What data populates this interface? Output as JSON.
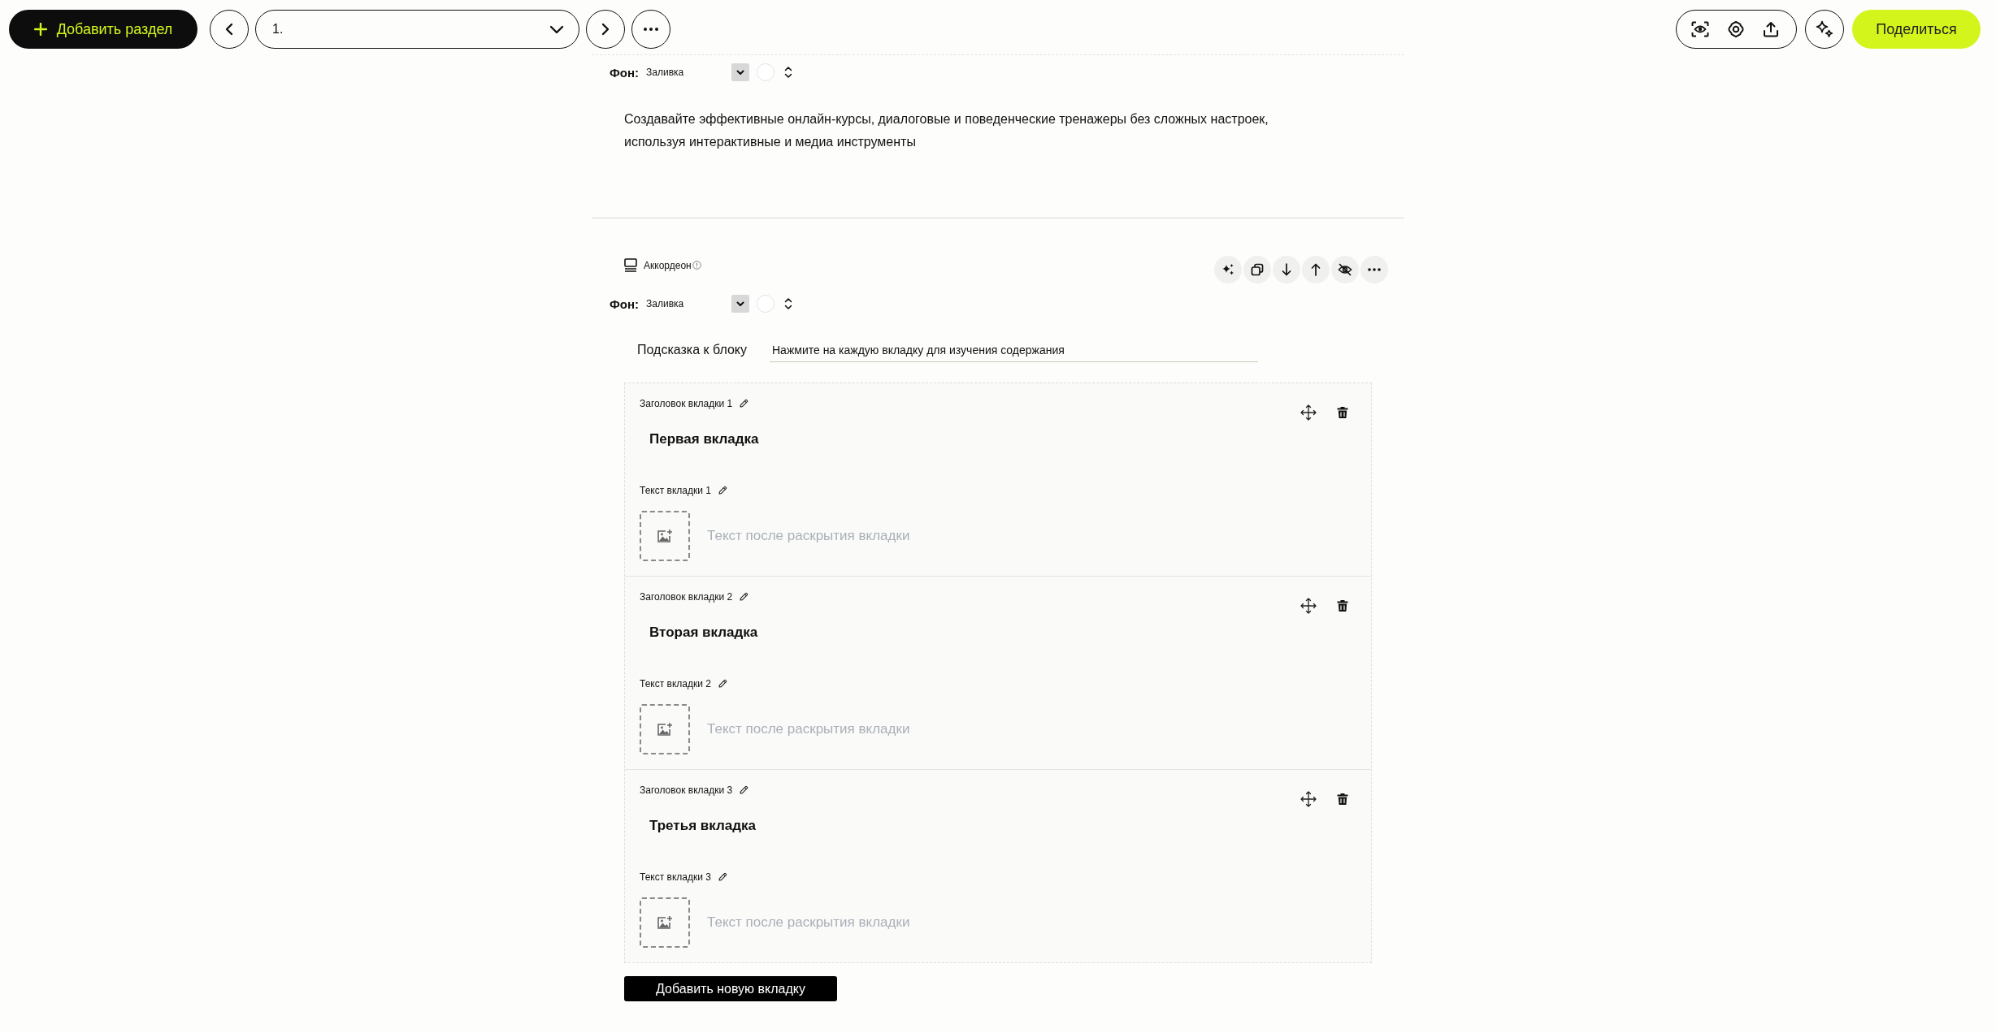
{
  "top_bar": {
    "add_section_button": "Добавить раздел",
    "section_select": {
      "value": "1."
    },
    "share_button": "Поделиться"
  },
  "blocks": [
    {
      "kind": "text",
      "background": {
        "label": "Фон:",
        "value": "Заливка"
      },
      "text": "Создавайте эффективные онлайн-курсы, диалоговые и поведенческие тренажеры без сложных настроек, используя интерактивные и медиа инструменты"
    },
    {
      "kind": "accordion",
      "type_label": "Аккордеон",
      "background": {
        "label": "Фон:",
        "value": "Заливка"
      },
      "hint": {
        "label": "Подсказка к блоку",
        "value": "Нажмите на каждую вкладку для изучения содержания"
      },
      "tabs": [
        {
          "title_label": "Заголовок вкладки 1",
          "title": "Первая вкладка",
          "body": {
            "label": "Текст вкладки 1",
            "placeholder": "Текст после раскрытия вкладки"
          }
        },
        {
          "title_label": "Заголовок вкладки 2",
          "title": "Вторая вкладка",
          "body": {
            "label": "Текст вкладки 2",
            "placeholder": "Текст после раскрытия вкладки"
          }
        },
        {
          "title_label": "Заголовок вкладки 3",
          "title": "Третья вкладка",
          "body": {
            "label": "Текст вкладки 3",
            "placeholder": "Текст после раскрытия вкладки"
          }
        }
      ],
      "add_tab_button": "Добавить новую вкладку"
    }
  ]
}
